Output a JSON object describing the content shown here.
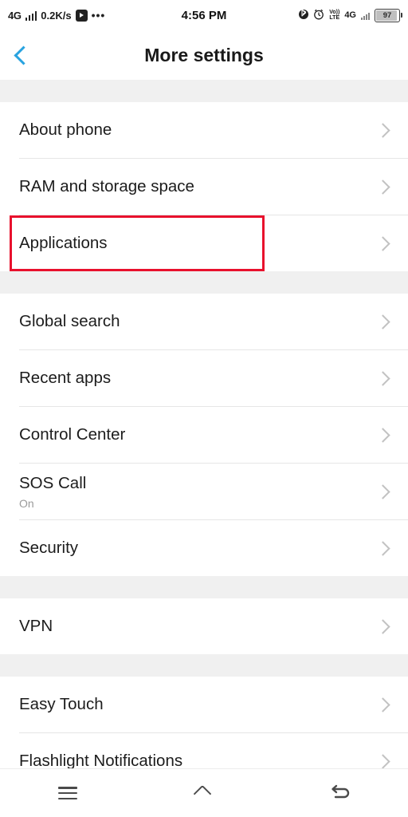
{
  "statusbar": {
    "network_type": "4G",
    "data_speed": "0.2K/s",
    "overflow_dots": "•••",
    "clock": "4:56 PM",
    "bluetooth_icon": "bluetooth-icon",
    "alarm_icon": "alarm-icon",
    "volte_top": "Vo))",
    "volte_bottom": "LTE",
    "second_network": "4G",
    "battery_percent": "97"
  },
  "header": {
    "back_icon": "back-chevron-icon",
    "title": "More settings"
  },
  "groups": [
    {
      "id": "group-device",
      "rows": [
        {
          "title": "About phone",
          "sub": "",
          "highlighted": false
        },
        {
          "title": "RAM and storage space",
          "sub": "",
          "highlighted": false
        },
        {
          "title": "Applications",
          "sub": "",
          "highlighted": true
        }
      ]
    },
    {
      "id": "group-system",
      "rows": [
        {
          "title": "Global search",
          "sub": "",
          "highlighted": false
        },
        {
          "title": "Recent apps",
          "sub": "",
          "highlighted": false
        },
        {
          "title": "Control Center",
          "sub": "",
          "highlighted": false
        },
        {
          "title": "SOS Call",
          "sub": "On",
          "highlighted": false
        },
        {
          "title": "Security",
          "sub": "",
          "highlighted": false
        }
      ]
    },
    {
      "id": "group-network",
      "rows": [
        {
          "title": "VPN",
          "sub": "",
          "highlighted": false
        }
      ]
    },
    {
      "id": "group-tools",
      "rows": [
        {
          "title": "Easy Touch",
          "sub": "",
          "highlighted": false
        },
        {
          "title": "Flashlight Notifications",
          "sub": "",
          "highlighted": false
        }
      ]
    }
  ],
  "navbar": {
    "menu_icon": "menu-icon",
    "home_icon": "home-icon",
    "back_icon": "back-arrow-icon"
  },
  "colors": {
    "accent": "#29a3e0",
    "highlight": "#e8112d",
    "page_bg": "#f0f0f0",
    "card_bg": "#ffffff"
  }
}
